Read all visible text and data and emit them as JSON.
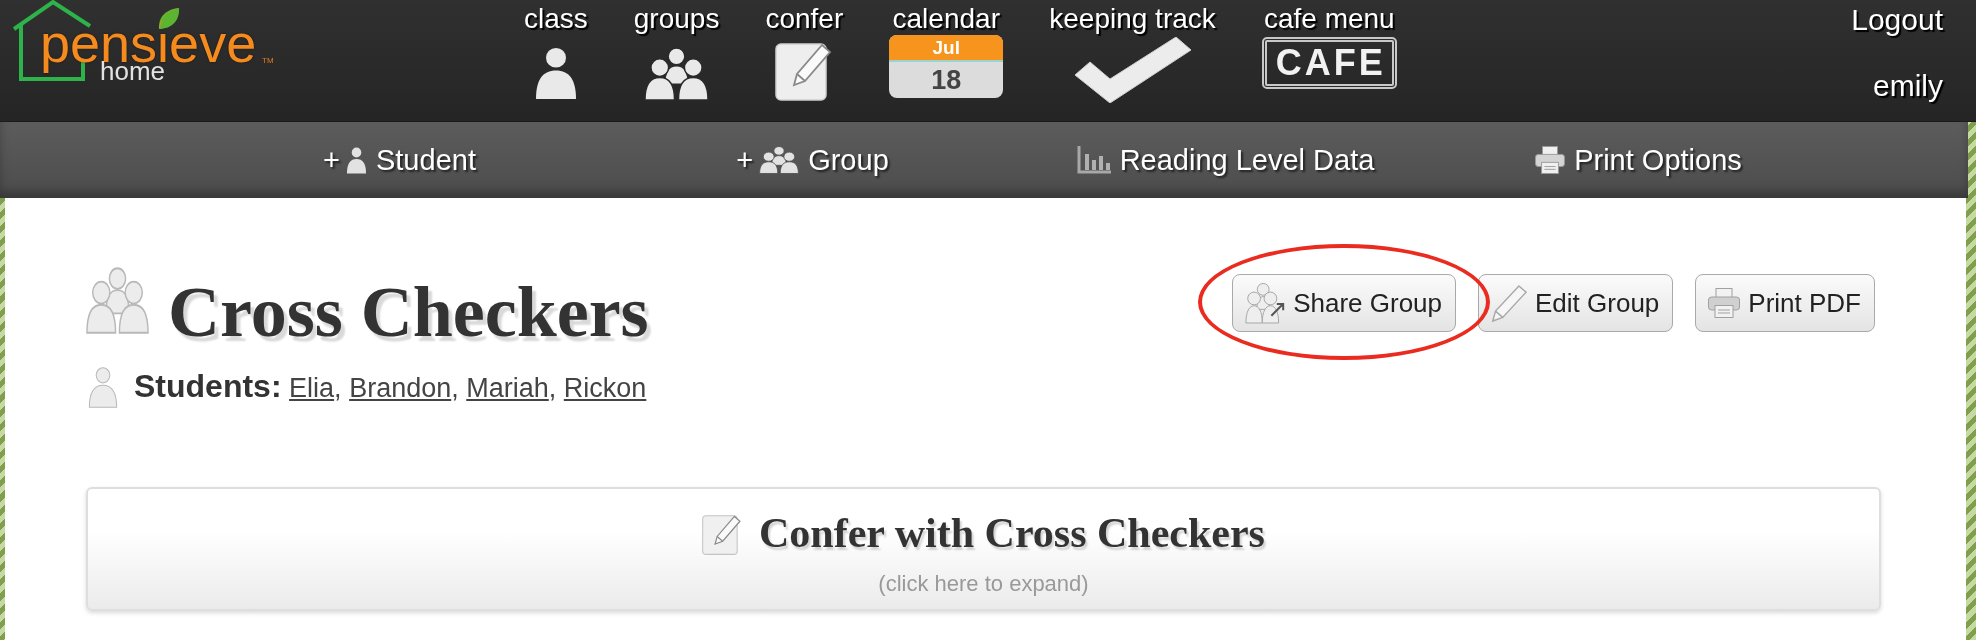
{
  "header": {
    "logo": {
      "wordmark": "pensieve",
      "subtitle": "home",
      "trademark": "TM"
    },
    "nav": [
      {
        "label": "class",
        "kind": "person"
      },
      {
        "label": "groups",
        "kind": "group"
      },
      {
        "label": "confer",
        "kind": "notepad"
      },
      {
        "label": "calendar",
        "kind": "calendar",
        "month": "Jul",
        "day": "18"
      },
      {
        "label": "keeping track",
        "kind": "check"
      },
      {
        "label": "cafe menu",
        "kind": "sign",
        "sign": "CAFE"
      }
    ],
    "account": {
      "logout": "Logout",
      "user": "emily"
    }
  },
  "toolbar": [
    {
      "prefix": "+",
      "label": "Student",
      "kind": "person"
    },
    {
      "prefix": "+",
      "label": "Group",
      "kind": "group"
    },
    {
      "label": "Reading Level Data",
      "kind": "chart"
    },
    {
      "label": "Print Options",
      "kind": "printer"
    }
  ],
  "group": {
    "title": "Cross Checkers",
    "students": {
      "label": "Students:",
      "names": [
        {
          "text": "Elia",
          "after": ","
        },
        {
          "text": "Brandon",
          "after": ","
        },
        {
          "text": "Mariah",
          "after": ","
        },
        {
          "text": "Rickon"
        }
      ]
    },
    "actions": [
      {
        "label": "Share Group",
        "kind": "share",
        "circled": true
      },
      {
        "label": "Edit Group",
        "kind": "pencil",
        "circled": false
      },
      {
        "label": "Print PDF",
        "kind": "printer",
        "circled": false
      }
    ]
  },
  "confer_panel": {
    "title": "Confer with Cross Checkers",
    "hint": "(click here to expand)"
  }
}
